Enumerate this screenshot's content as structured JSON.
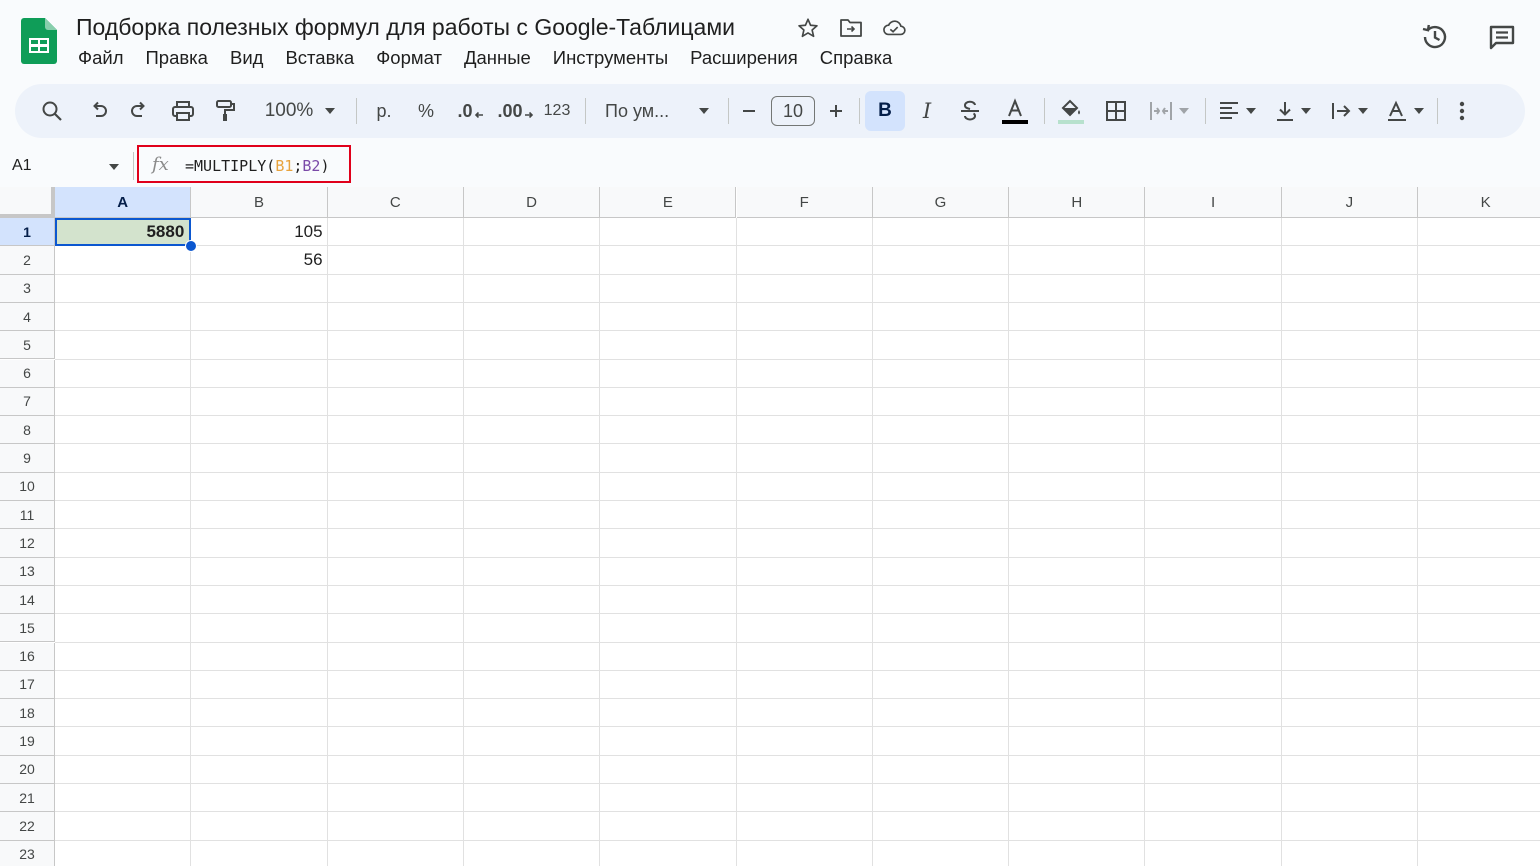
{
  "document": {
    "title": "Подборка полезных формул для работы с Google-Таблицами"
  },
  "menu": [
    "Файл",
    "Правка",
    "Вид",
    "Вставка",
    "Формат",
    "Данные",
    "Инструменты",
    "Расширения",
    "Справка"
  ],
  "toolbar": {
    "zoom": "100%",
    "currency": "р.",
    "percent": "%",
    "decimal_decrease": ".0",
    "decimal_increase": ".00",
    "number_format": "123",
    "font_family": "По ум...",
    "font_size": "10",
    "bold": "B",
    "italic": "I"
  },
  "formula_bar": {
    "cell_ref": "A1",
    "fx": "fx",
    "formula_prefix": "=MULTIPLY(",
    "ref1": "B1",
    "separator": ";",
    "ref2": "B2",
    "formula_suffix": ")"
  },
  "grid": {
    "columns": [
      "A",
      "B",
      "C",
      "D",
      "E",
      "F",
      "G",
      "H",
      "I",
      "J",
      "K"
    ],
    "rows": [
      "1",
      "2",
      "3",
      "4",
      "5",
      "6",
      "7",
      "8",
      "9",
      "10",
      "11",
      "12",
      "13",
      "14",
      "15",
      "16",
      "17",
      "18",
      "19",
      "20",
      "21",
      "22",
      "23"
    ],
    "cells": {
      "A1": "5880",
      "B1": "105",
      "B2": "56"
    },
    "selected_cell": "A1"
  },
  "colors": {
    "accent": "#0b57d0",
    "highlight_border": "#e0001b",
    "selected_fill": "#d3e3cd"
  }
}
